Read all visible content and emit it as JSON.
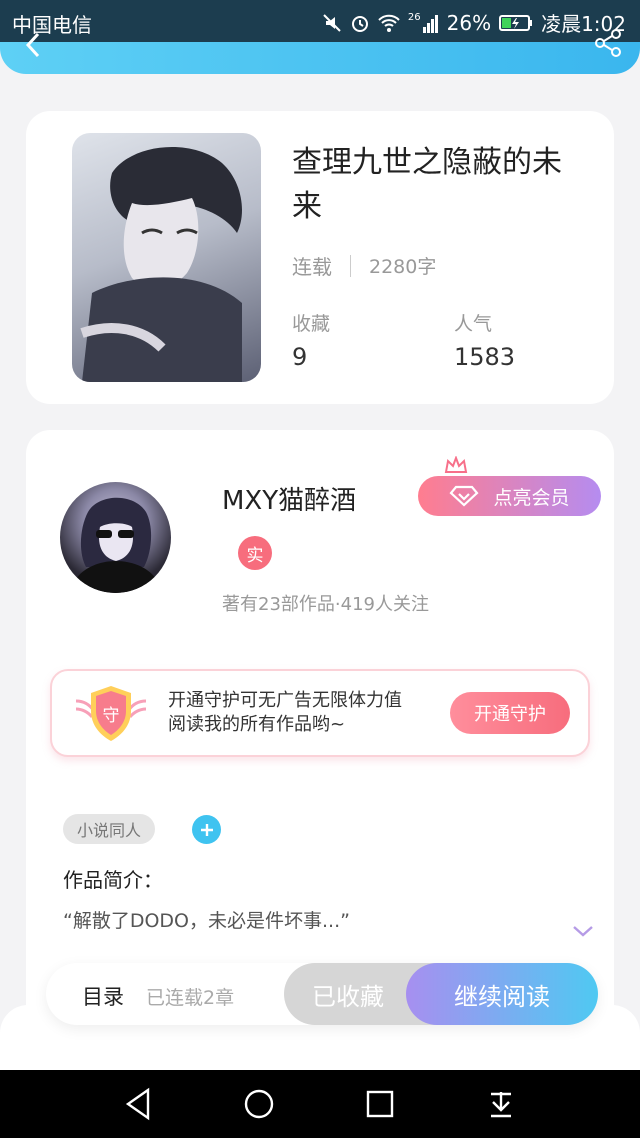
{
  "status_bar": {
    "carrier": "中国电信",
    "network": "26",
    "battery": "26%",
    "time": "凌晨1:02"
  },
  "book": {
    "title": "查理九世之隐蔽的未来",
    "status": "连载",
    "word_count": "2280字",
    "collect_label": "收藏",
    "collect_value": "9",
    "popularity_label": "人气",
    "popularity_value": "1583"
  },
  "author": {
    "name": "MXY猫醉酒",
    "member_button": "点亮会员",
    "real_badge": "实",
    "stats": "著有23部作品·419人关注"
  },
  "guard": {
    "icon_text": "守",
    "line1": "开通守护可无广告无限体力值",
    "line2": "阅读我的所有作品哟~",
    "button": "开通守护"
  },
  "tag": "小说同人",
  "intro": {
    "label": "作品简介：",
    "text": "“解散了DODO，未必是件坏事...”"
  },
  "action_bar": {
    "toc": "目录",
    "chapters": "已连载2章",
    "collected": "已收藏",
    "read": "继续阅读"
  },
  "colors": {
    "accent_blue": "#3fc3f0",
    "accent_pink": "#f76d7d",
    "accent_purple": "#a78ff0"
  }
}
